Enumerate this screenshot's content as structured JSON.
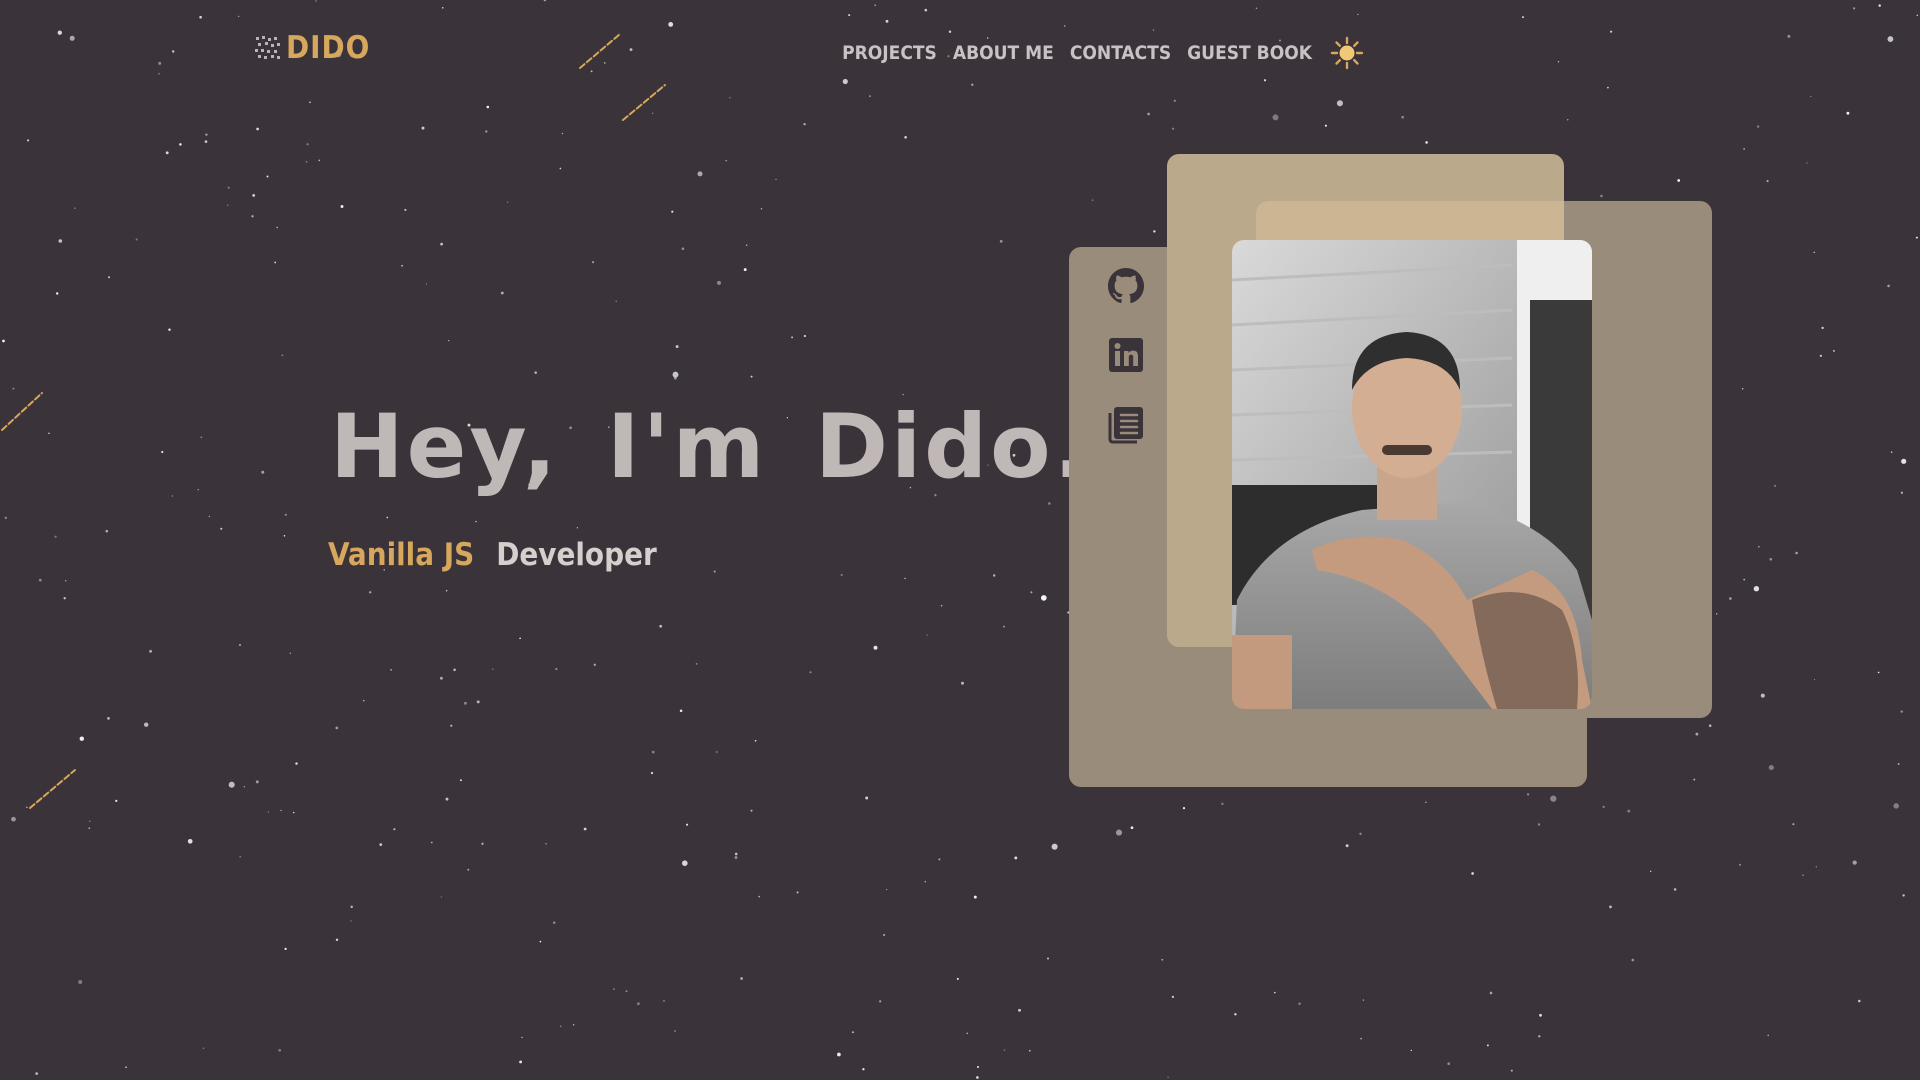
{
  "colors": {
    "background": "#3a3339",
    "accent": "#d6a75c",
    "heading": "#c0b8b6",
    "nav_text": "#c9c2c4",
    "card_taupe": "#9a8c7b",
    "card_tan": "#bba98c"
  },
  "header": {
    "logo_text": "DIDO",
    "nav": [
      {
        "label": "PROJECTS"
      },
      {
        "label": "ABOUT ME"
      },
      {
        "label": "CONTACTS"
      },
      {
        "label": "GUEST BOOK"
      }
    ],
    "theme_toggle_icon": "sun-icon"
  },
  "hero": {
    "title": "Hey, I'm Dido.",
    "subtitle_accent": "Vanilla JS",
    "subtitle_main": "Developer"
  },
  "social": [
    {
      "icon": "github-icon"
    },
    {
      "icon": "linkedin-icon"
    },
    {
      "icon": "resume-icon"
    }
  ],
  "photo": {
    "icon": "profile-photo"
  }
}
